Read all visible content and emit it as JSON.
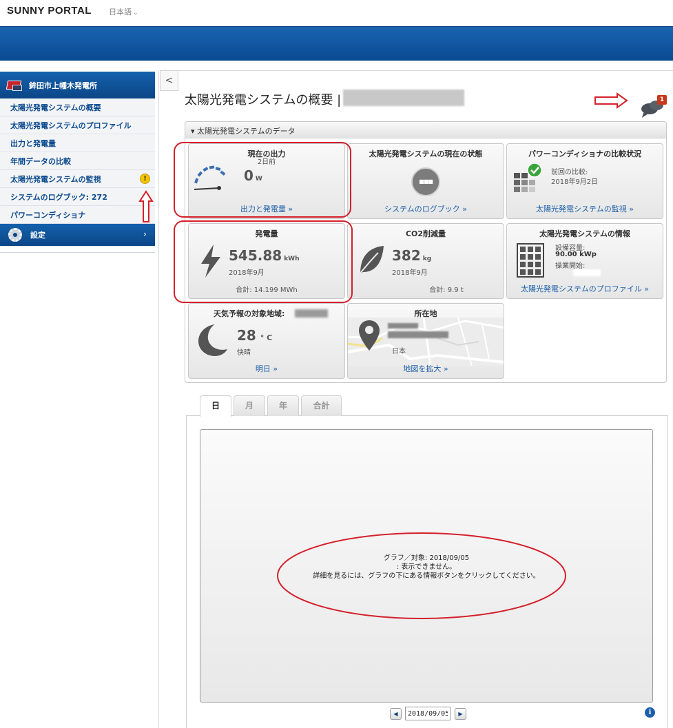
{
  "header": {
    "brand": "SUNNY PORTAL",
    "language": "日本語"
  },
  "sidebar": {
    "plant_name": "鉾田市上幡木発電所",
    "items": [
      {
        "label": "太陽光発電システムの概要"
      },
      {
        "label": "太陽光発電システムのプロファイル"
      },
      {
        "label": "出力と発電量"
      },
      {
        "label": "年間データの比較"
      },
      {
        "label": "太陽光発電システムの監視",
        "warning": "!"
      },
      {
        "label": "システムのログブック: 272"
      },
      {
        "label": "パワーコンディショナ"
      }
    ],
    "settings_label": "設定",
    "collapse_glyph": "<"
  },
  "page": {
    "title": "太陽光発電システムの概要 |",
    "notification_count": "1"
  },
  "data_panel": {
    "heading": "▾ 太陽光発電システムのデータ",
    "current_power": {
      "title": "現在の出力",
      "age": "2日前",
      "value": "0",
      "unit": "W",
      "link": "出力と発電量 »",
      "gauge_level": 0
    },
    "system_status": {
      "title": "太陽光発電システムの現在の状態",
      "status_glyph": "■■■",
      "link": "システムのログブック »"
    },
    "inverter_compare": {
      "title": "パワーコンディショナの比較状況",
      "line1": "前回の比較:",
      "line2": "2018年9月2日",
      "link": "太陽光発電システムの監視 »"
    },
    "yield": {
      "title": "発電量",
      "value": "545.88",
      "unit": "kWh",
      "period": "2018年9月",
      "total": "合計: 14.199 MWh"
    },
    "co2": {
      "title": "CO2削減量",
      "value": "382",
      "unit": "kg",
      "period": "2018年9月",
      "total": "合計: 9.9 t"
    },
    "system_info": {
      "title": "太陽光発電システムの情報",
      "capacity_label": "設備容量:",
      "capacity_value": "90.00 kWp",
      "start_label": "操業開始:",
      "link": "太陽光発電システムのプロファイル »"
    },
    "weather": {
      "title": "天気予報の対象地域:",
      "temp": "28",
      "unit": "° C",
      "condition": "快晴",
      "link": "明日 »"
    },
    "location": {
      "title": "所在地",
      "country": "日本",
      "link": "地図を拡大 »"
    }
  },
  "tabs": [
    {
      "label": "日"
    },
    {
      "label": "月"
    },
    {
      "label": "年"
    },
    {
      "label": "合計"
    }
  ],
  "chart": {
    "line1": "グラフ／対象: 2018/09/05",
    "line2": ": 表示できません。",
    "line3": "詳細を見るには、グラフの下にある情報ボタンをクリックしてください。",
    "date_value": "2018/09/05",
    "prev_glyph": "◀",
    "next_glyph": "▶",
    "info_glyph": "i"
  },
  "annotation_color": "#d4202a"
}
